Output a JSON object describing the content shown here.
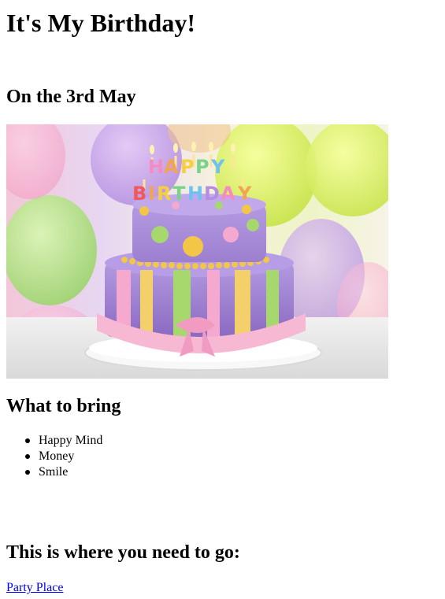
{
  "page": {
    "title": "It's My Birthday!",
    "date_heading": "On the 3rd May",
    "bring_heading": "What to bring",
    "bring_items": [
      "Happy Mind",
      "Money",
      "Smile"
    ],
    "directions_heading": "This is where you need to go:",
    "link_label": "Party Place"
  },
  "image": {
    "alt": "Birthday cake",
    "cake_topper_text": "HAPPY BIRTHDAY"
  },
  "colors": {
    "link": "#0000ee",
    "text": "#000000",
    "background": "#ffffff"
  }
}
